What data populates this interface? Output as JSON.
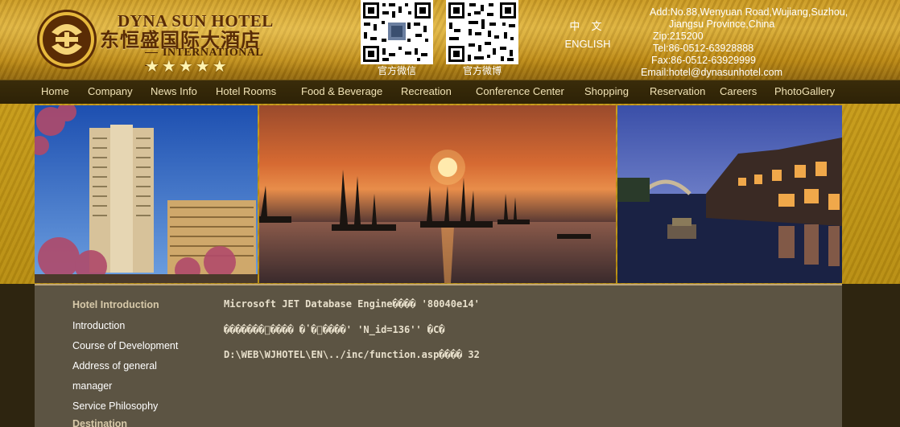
{
  "logo": {
    "name_en": "DYNA SUN HOTEL",
    "name_cn": "东恒盛国际大酒店",
    "sub": "INTERNATIONAL",
    "stars": "★★★★★"
  },
  "qr_codes": [
    {
      "caption": "官方微信"
    },
    {
      "caption": "官方微博"
    }
  ],
  "language": {
    "chinese": "中 文",
    "english": "ENGLISH"
  },
  "contact": {
    "address_1": "Add:No.88,Wenyuan Road,Wujiang,Suzhou,",
    "address_2": "Jiangsu Province,China",
    "zip": "Zip:215200",
    "tel": "Tel:86-0512-63928888",
    "fax": "Fax:86-0512-63929999",
    "email": "Email:hotel@dynasunhotel.com"
  },
  "nav": {
    "items": [
      {
        "label": "Home"
      },
      {
        "label": "Company"
      },
      {
        "label": "News Info"
      },
      {
        "label": "Hotel Rooms"
      },
      {
        "label": "Food & Beverage"
      },
      {
        "label": "Recreation"
      },
      {
        "label": "Conference Center"
      },
      {
        "label": "Shopping"
      },
      {
        "label": "Reservation"
      },
      {
        "label": "Careers"
      },
      {
        "label": "PhotoGallery"
      }
    ]
  },
  "sidebar": {
    "heading": "Hotel Introduction",
    "items": [
      {
        "label": "Introduction"
      },
      {
        "label": "Course of Development"
      },
      {
        "label": "Address of general"
      },
      {
        "label": "manager"
      },
      {
        "label": "Service Philosophy"
      }
    ],
    "next_heading": "Destination"
  },
  "error": {
    "line1": "Microsoft JET Database Engine���� '80040e14'",
    "line2": "�������\b���� �ʽ�﷨����' 'N_id=136'' �С�",
    "line3": "D:\\WEB\\WJHOTEL\\EN\\../inc/function.asp���� 32"
  },
  "colors": {
    "gold": "#c99a25",
    "nav_bg": "#2d2206",
    "content_bg": "#5c5443",
    "sidebar_heading": "#d7c9a9"
  }
}
